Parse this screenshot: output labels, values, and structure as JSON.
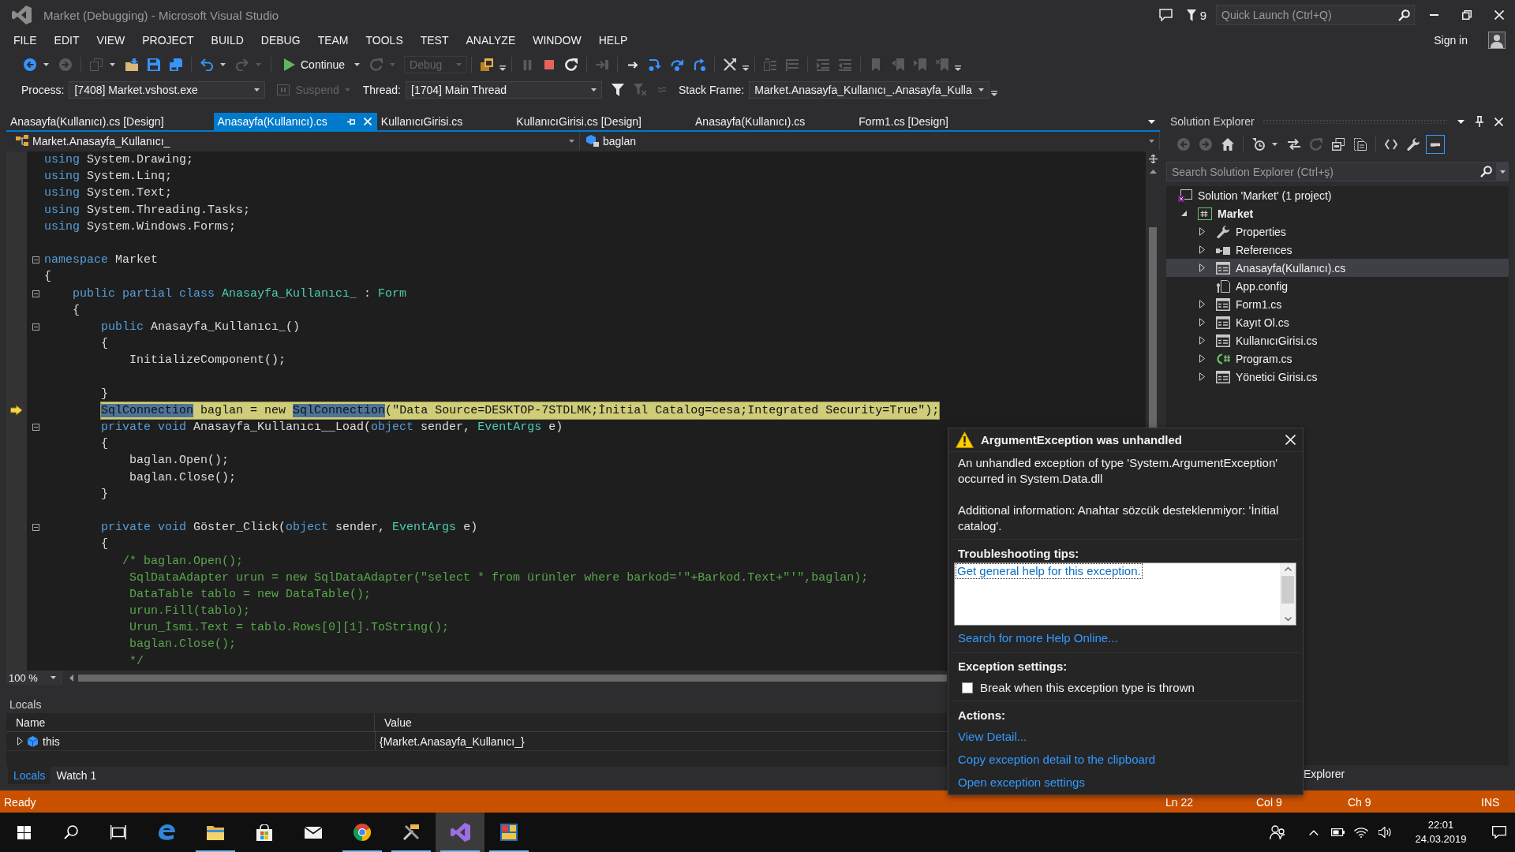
{
  "window": {
    "title": "Market (Debugging) - Microsoft Visual Studio",
    "notification_count": "9",
    "quick_launch": {
      "placeholder": "Quick Launch (Ctrl+Q)"
    },
    "sign_in": "Sign in"
  },
  "menu": [
    "FILE",
    "EDIT",
    "VIEW",
    "PROJECT",
    "BUILD",
    "DEBUG",
    "TEAM",
    "TOOLS",
    "TEST",
    "ANALYZE",
    "WINDOW",
    "HELP"
  ],
  "toolbar": [
    {
      "kind": "back",
      "disabled": false
    },
    {
      "kind": "dropdown-caret",
      "disabled": false
    },
    {
      "kind": "forward",
      "disabled": true
    },
    {
      "kind": "separator"
    },
    {
      "kind": "new-project",
      "disabled": true
    },
    {
      "kind": "dropdown-caret",
      "disabled": false
    },
    {
      "kind": "open",
      "disabled": false
    },
    {
      "kind": "save",
      "disabled": false
    },
    {
      "kind": "save-all",
      "disabled": false
    },
    {
      "kind": "separator"
    },
    {
      "kind": "undo",
      "disabled": false
    },
    {
      "kind": "dropdown-caret",
      "disabled": false
    },
    {
      "kind": "redo",
      "disabled": true
    },
    {
      "kind": "dropdown-caret",
      "disabled": true
    },
    {
      "kind": "separator"
    },
    {
      "kind": "continue",
      "label": "Continue",
      "disabled": false
    },
    {
      "kind": "dropdown-caret",
      "disabled": false
    },
    {
      "kind": "refresh",
      "disabled": true
    },
    {
      "kind": "dropdown-caret",
      "disabled": true
    },
    {
      "kind": "combo",
      "label": "Debug",
      "disabled": true
    },
    {
      "kind": "separator"
    },
    {
      "kind": "stack",
      "disabled": false
    },
    {
      "kind": "overflow"
    },
    {
      "kind": "separator"
    },
    {
      "kind": "pause",
      "disabled": true
    },
    {
      "kind": "stop",
      "disabled": false
    },
    {
      "kind": "restart",
      "disabled": false
    },
    {
      "kind": "separator"
    },
    {
      "kind": "show-next",
      "disabled": true
    },
    {
      "kind": "separator"
    },
    {
      "kind": "step-arrow",
      "disabled": false
    },
    {
      "kind": "step-into",
      "disabled": false
    },
    {
      "kind": "step-over",
      "disabled": false
    },
    {
      "kind": "step-out",
      "disabled": false
    },
    {
      "kind": "separator"
    },
    {
      "kind": "hex",
      "disabled": false
    },
    {
      "kind": "overflow"
    },
    {
      "kind": "separator"
    },
    {
      "kind": "comment-lines",
      "disabled": true
    },
    {
      "kind": "uncomment-lines",
      "disabled": true
    },
    {
      "kind": "separator"
    },
    {
      "kind": "indent-lines",
      "disabled": true
    },
    {
      "kind": "outdent-lines",
      "disabled": true
    },
    {
      "kind": "separator"
    },
    {
      "kind": "bookmark",
      "disabled": true
    },
    {
      "kind": "bookmark-prev",
      "disabled": true
    },
    {
      "kind": "bookmark-next",
      "disabled": true
    },
    {
      "kind": "bookmark-clear",
      "disabled": true
    },
    {
      "kind": "overflow"
    }
  ],
  "debug_location": {
    "process_label": "Process:",
    "process": "[7408] Market.vshost.exe",
    "suspend": {
      "label": "Suspend",
      "disabled": true
    },
    "thread_label": "Thread:",
    "thread": "[1704] Main Thread",
    "thread_tools": [
      {
        "kind": "filter",
        "disabled": false
      },
      {
        "kind": "filter-clear",
        "disabled": true
      },
      {
        "kind": "thread-flag",
        "disabled": true
      }
    ],
    "stack_frame_label": "Stack Frame:",
    "stack_frame": "Market.Anasayfa_Kullanıcı_.Anasayfa_Kulla"
  },
  "document_tabs": [
    {
      "label": "Anasayfa(Kullanıcı).cs [Design]",
      "selected": false
    },
    {
      "label": "Anasayfa(Kullanıcı).cs",
      "selected": true
    },
    {
      "label": "KullanıcıGirisi.cs",
      "selected": false
    },
    {
      "label": "KullanıcıGirisi.cs [Design]",
      "selected": false
    },
    {
      "label": "Anasayfa(Kullanıcı).cs",
      "selected": false
    },
    {
      "label": "Form1.cs [Design]",
      "selected": false
    }
  ],
  "navigation": {
    "type": "Market.Anasayfa_Kullanıcı_",
    "member": "baglan"
  },
  "editor": {
    "lines": [
      {
        "tokens": [
          {
            "text": "using",
            "kind": "keyword"
          },
          {
            "text": " System.Drawing;",
            "kind": "plain"
          }
        ],
        "fold": false,
        "current": false
      },
      {
        "tokens": [
          {
            "text": "using",
            "kind": "keyword"
          },
          {
            "text": " System.Linq;",
            "kind": "plain"
          }
        ],
        "fold": false,
        "current": false
      },
      {
        "tokens": [
          {
            "text": "using",
            "kind": "keyword"
          },
          {
            "text": " System.Text;",
            "kind": "plain"
          }
        ],
        "fold": false,
        "current": false
      },
      {
        "tokens": [
          {
            "text": "using",
            "kind": "keyword"
          },
          {
            "text": " System.Threading.Tasks;",
            "kind": "plain"
          }
        ],
        "fold": false,
        "current": false
      },
      {
        "tokens": [
          {
            "text": "using",
            "kind": "keyword"
          },
          {
            "text": " System.Windows.Forms;",
            "kind": "plain"
          }
        ],
        "fold": false,
        "current": false
      },
      {
        "fold": false,
        "current": false
      },
      {
        "tokens": [
          {
            "text": "namespace",
            "kind": "keyword"
          },
          {
            "text": " Market",
            "kind": "plain"
          }
        ],
        "fold": true,
        "current": false
      },
      {
        "tokens": [
          {
            "text": "{",
            "kind": "plain"
          }
        ],
        "fold": false,
        "current": false
      },
      {
        "tokens": [
          {
            "text": "    public partial class ",
            "kind": "keyword"
          },
          {
            "text": "Anasayfa_Kullanıcı_",
            "kind": "type"
          },
          {
            "text": " : ",
            "kind": "plain"
          },
          {
            "text": "Form",
            "kind": "type"
          }
        ],
        "fold": true,
        "current": false
      },
      {
        "tokens": [
          {
            "text": "    {",
            "kind": "plain"
          }
        ],
        "fold": false,
        "current": false
      },
      {
        "tokens": [
          {
            "text": "        public",
            "kind": "keyword"
          },
          {
            "text": " Anasayfa_Kullanıcı_()",
            "kind": "plain"
          }
        ],
        "fold": true,
        "current": false
      },
      {
        "tokens": [
          {
            "text": "        {",
            "kind": "plain"
          }
        ],
        "fold": false,
        "current": false
      },
      {
        "tokens": [
          {
            "text": "            InitializeComponent();",
            "kind": "plain"
          }
        ],
        "fold": false,
        "current": false
      },
      {
        "fold": false,
        "current": false
      },
      {
        "tokens": [
          {
            "text": "        }",
            "kind": "plain"
          }
        ],
        "fold": false,
        "current": false
      },
      {
        "tokens": [
          {
            "text": "        SqlConnection",
            "kind": "reference"
          },
          {
            "text": " baglan = ",
            "kind": "plain"
          },
          {
            "text": "new ",
            "kind": "keyword"
          },
          {
            "text": "SqlConnection",
            "kind": "reference"
          },
          {
            "text": "(",
            "kind": "plain"
          },
          {
            "text": "\"Data Source=DESKTOP-7STDLMK;İnitial Catalog=cesa;Integrated Security=True\"",
            "kind": "string"
          },
          {
            "text": ");",
            "kind": "plain"
          }
        ],
        "fold": false,
        "current": true
      },
      {
        "tokens": [
          {
            "text": "        private void",
            "kind": "keyword"
          },
          {
            "text": " Anasayfa_Kullanıcı__Load(",
            "kind": "plain"
          },
          {
            "text": "object",
            "kind": "keyword"
          },
          {
            "text": " sender, ",
            "kind": "plain"
          },
          {
            "text": "EventArgs",
            "kind": "type"
          },
          {
            "text": " e)",
            "kind": "plain"
          }
        ],
        "fold": true,
        "current": false
      },
      {
        "tokens": [
          {
            "text": "        {",
            "kind": "plain"
          }
        ],
        "fold": false,
        "current": false
      },
      {
        "tokens": [
          {
            "text": "            baglan.Open();",
            "kind": "plain"
          }
        ],
        "fold": false,
        "current": false
      },
      {
        "tokens": [
          {
            "text": "            baglan.Close();",
            "kind": "plain"
          }
        ],
        "fold": false,
        "current": false
      },
      {
        "tokens": [
          {
            "text": "        }",
            "kind": "plain"
          }
        ],
        "fold": false,
        "current": false
      },
      {
        "fold": false,
        "current": false
      },
      {
        "tokens": [
          {
            "text": "        private void",
            "kind": "keyword"
          },
          {
            "text": " Göster_Click(",
            "kind": "plain"
          },
          {
            "text": "object",
            "kind": "keyword"
          },
          {
            "text": " sender, ",
            "kind": "plain"
          },
          {
            "text": "EventArgs",
            "kind": "type"
          },
          {
            "text": " e)",
            "kind": "plain"
          }
        ],
        "fold": true,
        "current": false
      },
      {
        "tokens": [
          {
            "text": "        {",
            "kind": "plain"
          }
        ],
        "fold": false,
        "current": false
      },
      {
        "tokens": [
          {
            "text": "           /* baglan.Open();",
            "kind": "comment"
          }
        ],
        "fold": false,
        "current": false
      },
      {
        "tokens": [
          {
            "text": "            SqlDataAdapter urun = new SqlDataAdapter(\"select * from ürünler where barkod='\"+Barkod.Text+\"'\",baglan);",
            "kind": "comment"
          }
        ],
        "fold": false,
        "current": false
      },
      {
        "tokens": [
          {
            "text": "            DataTable tablo = new DataTable();",
            "kind": "comment"
          }
        ],
        "fold": false,
        "current": false
      },
      {
        "tokens": [
          {
            "text": "            urun.Fill(tablo);",
            "kind": "comment"
          }
        ],
        "fold": false,
        "current": false
      },
      {
        "tokens": [
          {
            "text": "            Urun_İsmi.Text = tablo.Rows[0][1].ToString();",
            "kind": "comment"
          }
        ],
        "fold": false,
        "current": false
      },
      {
        "tokens": [
          {
            "text": "            baglan.Close();",
            "kind": "comment"
          }
        ],
        "fold": false,
        "current": false
      },
      {
        "tokens": [
          {
            "text": "            */",
            "kind": "comment"
          }
        ],
        "fold": false,
        "current": false
      }
    ]
  },
  "zoom": "100 %",
  "locals": {
    "title": "Locals",
    "columns": [
      "Name",
      "Value"
    ],
    "rows": [
      {
        "name": "this",
        "value": "{Market.Anasayfa_Kullanıcı_}",
        "expanded": false
      }
    ],
    "tabs": [
      {
        "label": "Locals",
        "selected": true
      },
      {
        "label": "Watch 1",
        "selected": false
      }
    ]
  },
  "solution_explorer": {
    "title": "Solution Explorer",
    "toolbar": [
      {
        "kind": "back",
        "disabled": true,
        "on": false
      },
      {
        "kind": "forward",
        "disabled": true,
        "on": false
      },
      {
        "kind": "home",
        "disabled": false,
        "on": false
      },
      {
        "kind": "separator"
      },
      {
        "kind": "history",
        "disabled": false,
        "on": false
      },
      {
        "kind": "dropdown-caret",
        "disabled": false
      },
      {
        "kind": "sync",
        "disabled": false,
        "on": false
      },
      {
        "kind": "refresh",
        "disabled": true,
        "on": false
      },
      {
        "kind": "collapse-all",
        "disabled": false,
        "on": false
      },
      {
        "kind": "show-all",
        "disabled": false,
        "on": false
      },
      {
        "kind": "separator"
      },
      {
        "kind": "code",
        "disabled": false,
        "on": false
      },
      {
        "kind": "properties",
        "disabled": false,
        "on": false
      },
      {
        "kind": "preview",
        "disabled": false,
        "on": true
      }
    ],
    "search": {
      "placeholder": "Search Solution Explorer (Ctrl+ş)"
    },
    "tree": [
      {
        "label": "Solution 'Market' (1 project)",
        "kind": "solution",
        "selected": false
      },
      {
        "label": "Market",
        "kind": "project",
        "expanded": true,
        "selected": false,
        "children": [
          {
            "label": "Properties",
            "kind": "properties",
            "expanded": false,
            "selected": false
          },
          {
            "label": "References",
            "kind": "references",
            "expanded": false,
            "selected": false
          },
          {
            "label": "Anasayfa(Kullanıcı).cs",
            "kind": "form",
            "expanded": false,
            "selected": true
          },
          {
            "label": "App.config",
            "kind": "config",
            "selected": false
          },
          {
            "label": "Form1.cs",
            "kind": "form",
            "expanded": false,
            "selected": false
          },
          {
            "label": "Kayıt Ol.cs",
            "kind": "form",
            "expanded": false,
            "selected": false
          },
          {
            "label": "KullanıcıGirisi.cs",
            "kind": "form",
            "expanded": false,
            "selected": false
          },
          {
            "label": "Program.cs",
            "kind": "csharp",
            "expanded": false,
            "selected": false
          },
          {
            "label": "Yönetici Girisi.cs",
            "kind": "form",
            "expanded": false,
            "selected": false
          }
        ]
      }
    ],
    "tabs": [
      {
        "label": "Explorer",
        "selected": false
      }
    ]
  },
  "exception": {
    "title": "ArgumentException was unhandled",
    "message": "An unhandled exception of type 'System.ArgumentException' occurred in System.Data.dll",
    "info": "Additional information: Anahtar sözcük desteklenmiyor: 'İnitial catalog'.",
    "tips_heading": "Troubleshooting tips:",
    "tips": [
      "Get general help for this exception."
    ],
    "help_link": "Search for more Help Online...",
    "settings_heading": "Exception settings:",
    "break_option": {
      "label": "Break when this exception type is thrown",
      "checked": false
    },
    "actions_heading": "Actions:",
    "actions": [
      "View Detail...",
      "Copy exception detail to the clipboard",
      "Open exception settings"
    ]
  },
  "status_bar": {
    "message": "Ready",
    "line": "Ln 22",
    "column": "Col 9",
    "character": "Ch 9",
    "mode": "INS"
  },
  "taskbar": {
    "apps": [
      {
        "kind": "edge",
        "running": false,
        "active": false
      },
      {
        "kind": "file-explorer",
        "running": true,
        "active": false
      },
      {
        "kind": "store",
        "running": false,
        "active": false
      },
      {
        "kind": "mail",
        "running": false,
        "active": false
      },
      {
        "kind": "chrome",
        "running": true,
        "active": false
      },
      {
        "kind": "tools",
        "running": true,
        "active": false
      },
      {
        "kind": "visual-studio",
        "running": true,
        "active": true
      },
      {
        "kind": "app",
        "running": true,
        "active": false
      }
    ],
    "time": "22:01",
    "date": "24.03.2019"
  }
}
